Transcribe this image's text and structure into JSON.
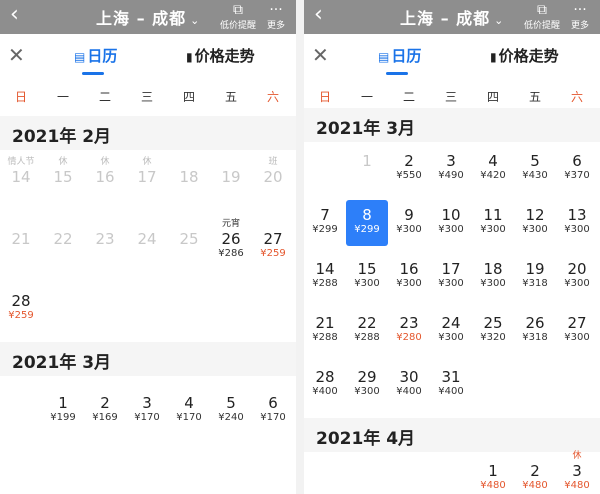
{
  "header": {
    "back_icon": "‹",
    "title": "上海 – 成都",
    "dropdown_icon": "⌄",
    "actions": [
      {
        "icon": "chart-trend-icon",
        "glyph": "⧉",
        "label": "低价提醒"
      },
      {
        "icon": "more-icon",
        "glyph": "···",
        "label": "更多"
      }
    ]
  },
  "sheet": {
    "close_icon": "✕",
    "tabs": [
      {
        "icon_glyph": "▤",
        "label": "日历",
        "active": true
      },
      {
        "icon_glyph": "▮",
        "label": "价格走势",
        "active": false
      }
    ],
    "weekdays": [
      "日",
      "一",
      "二",
      "三",
      "四",
      "五",
      "六"
    ]
  },
  "left": {
    "months": [
      {
        "title": "2021年 2月",
        "rows": [
          [
            {
              "d": "14",
              "tag": "情人节",
              "gray": true
            },
            {
              "d": "15",
              "tag": "休",
              "gray": true
            },
            {
              "d": "16",
              "tag": "休",
              "gray": true
            },
            {
              "d": "17",
              "tag": "休",
              "gray": true
            },
            {
              "d": "18",
              "gray": true
            },
            {
              "d": "19",
              "gray": true
            },
            {
              "d": "20",
              "tag": "班",
              "gray": true
            }
          ],
          [
            {
              "d": "21",
              "gray": true
            },
            {
              "d": "22",
              "gray": true
            },
            {
              "d": "23",
              "gray": true
            },
            {
              "d": "24",
              "gray": true
            },
            {
              "d": "25",
              "gray": true
            },
            {
              "d": "26",
              "tag": "元宵",
              "tag_on": true,
              "p": "¥286"
            },
            {
              "d": "27",
              "p": "¥259",
              "low": true
            }
          ],
          [
            {
              "d": "28",
              "p": "¥259",
              "low": true
            }
          ]
        ]
      },
      {
        "title": "2021年 3月",
        "rows": [
          [
            {
              "d": "",
              "empty": true
            },
            {
              "d": "1",
              "p": "¥199"
            },
            {
              "d": "2",
              "p": "¥169"
            },
            {
              "d": "3",
              "p": "¥170"
            },
            {
              "d": "4",
              "p": "¥170"
            },
            {
              "d": "5",
              "p": "¥240"
            },
            {
              "d": "6",
              "p": "¥170"
            }
          ]
        ]
      }
    ]
  },
  "right": {
    "months": [
      {
        "title": "2021年 3月",
        "rows": [
          [
            {
              "d": "",
              "empty": true
            },
            {
              "d": "1",
              "gray": true
            },
            {
              "d": "2",
              "p": "¥550"
            },
            {
              "d": "3",
              "p": "¥490"
            },
            {
              "d": "4",
              "p": "¥420"
            },
            {
              "d": "5",
              "p": "¥430"
            },
            {
              "d": "6",
              "p": "¥370"
            }
          ],
          [
            {
              "d": "7",
              "p": "¥299"
            },
            {
              "d": "8",
              "p": "¥299",
              "selected": true
            },
            {
              "d": "9",
              "p": "¥300"
            },
            {
              "d": "10",
              "p": "¥300"
            },
            {
              "d": "11",
              "p": "¥300"
            },
            {
              "d": "12",
              "p": "¥300"
            },
            {
              "d": "13",
              "p": "¥300"
            }
          ],
          [
            {
              "d": "14",
              "p": "¥288"
            },
            {
              "d": "15",
              "p": "¥300"
            },
            {
              "d": "16",
              "p": "¥300"
            },
            {
              "d": "17",
              "p": "¥300"
            },
            {
              "d": "18",
              "p": "¥300"
            },
            {
              "d": "19",
              "p": "¥318"
            },
            {
              "d": "20",
              "p": "¥300"
            }
          ],
          [
            {
              "d": "21",
              "p": "¥288"
            },
            {
              "d": "22",
              "p": "¥288"
            },
            {
              "d": "23",
              "p": "¥280",
              "low": true
            },
            {
              "d": "24",
              "p": "¥300"
            },
            {
              "d": "25",
              "p": "¥320"
            },
            {
              "d": "26",
              "p": "¥318"
            },
            {
              "d": "27",
              "p": "¥300"
            }
          ],
          [
            {
              "d": "28",
              "p": "¥400"
            },
            {
              "d": "29",
              "p": "¥300"
            },
            {
              "d": "30",
              "p": "¥400"
            },
            {
              "d": "31",
              "p": "¥400"
            }
          ]
        ]
      },
      {
        "title": "2021年 4月",
        "rows": [
          [
            {
              "d": "",
              "empty": true
            },
            {
              "d": "",
              "empty": true
            },
            {
              "d": "",
              "empty": true
            },
            {
              "d": "",
              "empty": true
            },
            {
              "d": "1",
              "p": "¥480",
              "low": true
            },
            {
              "d": "2",
              "p": "¥480",
              "low": true
            },
            {
              "d": "3",
              "tag": "休",
              "tag_hol": true,
              "p": "¥480",
              "low": true
            }
          ]
        ]
      }
    ]
  },
  "colors": {
    "accent": "#2d7ff9",
    "weekend": "#e4572e",
    "low_price": "#e4572e"
  }
}
